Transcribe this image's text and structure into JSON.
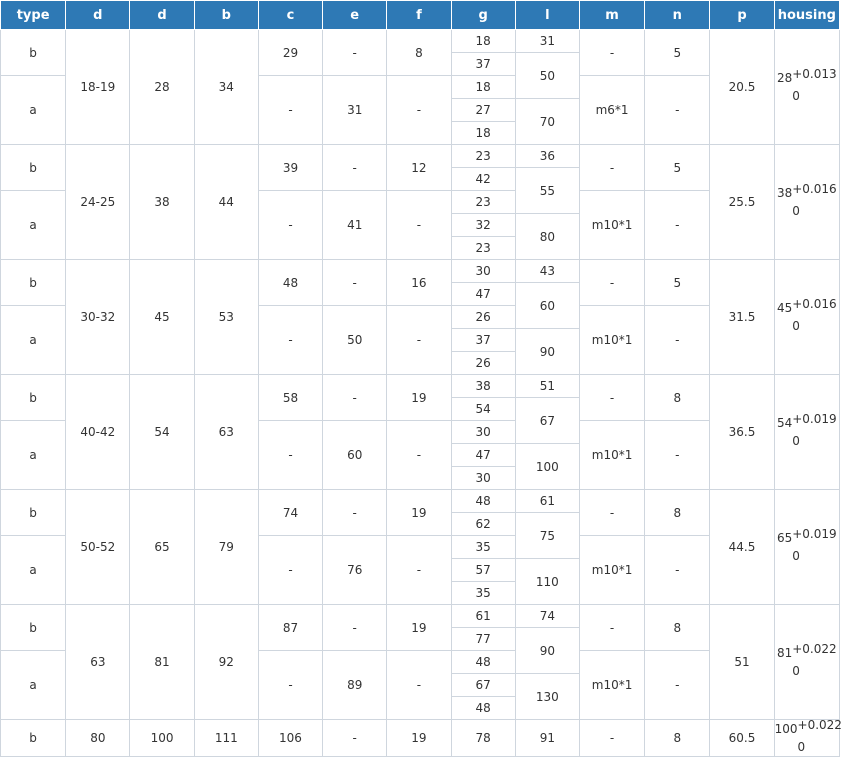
{
  "headers": [
    "type",
    "d",
    "d",
    "b",
    "c",
    "e",
    "f",
    "g",
    "l",
    "m",
    "n",
    "p",
    "housing"
  ],
  "groups": [
    {
      "d": "18-19",
      "d2": "28",
      "b": "34",
      "p": "20.5",
      "housing": {
        "base": "28",
        "upper": "+0.013",
        "lower": "0"
      },
      "b_row": {
        "type": "b",
        "c": "29",
        "e": "-",
        "f": "8",
        "m": "-",
        "n": "5"
      },
      "a_row": {
        "type": "a",
        "c": "-",
        "e": "31",
        "f": "-",
        "m": "m6*1",
        "n": "-"
      },
      "g": [
        "18",
        "37",
        "18",
        "27",
        "18"
      ],
      "l": [
        "31",
        "50",
        "70"
      ]
    },
    {
      "d": "24-25",
      "d2": "38",
      "b": "44",
      "p": "25.5",
      "housing": {
        "base": "38",
        "upper": "+0.016",
        "lower": "0"
      },
      "b_row": {
        "type": "b",
        "c": "39",
        "e": "-",
        "f": "12",
        "m": "-",
        "n": "5"
      },
      "a_row": {
        "type": "a",
        "c": "-",
        "e": "41",
        "f": "-",
        "m": "m10*1",
        "n": "-"
      },
      "g": [
        "23",
        "42",
        "23",
        "32",
        "23"
      ],
      "l": [
        "36",
        "55",
        "80"
      ]
    },
    {
      "d": "30-32",
      "d2": "45",
      "b": "53",
      "p": "31.5",
      "housing": {
        "base": "45",
        "upper": "+0.016",
        "lower": "0"
      },
      "b_row": {
        "type": "b",
        "c": "48",
        "e": "-",
        "f": "16",
        "m": "-",
        "n": "5"
      },
      "a_row": {
        "type": "a",
        "c": "-",
        "e": "50",
        "f": "-",
        "m": "m10*1",
        "n": "-"
      },
      "g": [
        "30",
        "47",
        "26",
        "37",
        "26"
      ],
      "l": [
        "43",
        "60",
        "90"
      ]
    },
    {
      "d": "40-42",
      "d2": "54",
      "b": "63",
      "p": "36.5",
      "housing": {
        "base": "54",
        "upper": "+0.019",
        "lower": "0"
      },
      "b_row": {
        "type": "b",
        "c": "58",
        "e": "-",
        "f": "19",
        "m": "-",
        "n": "8"
      },
      "a_row": {
        "type": "a",
        "c": "-",
        "e": "60",
        "f": "-",
        "m": "m10*1",
        "n": "-"
      },
      "g": [
        "38",
        "54",
        "30",
        "47",
        "30"
      ],
      "l": [
        "51",
        "67",
        "100"
      ]
    },
    {
      "d": "50-52",
      "d2": "65",
      "b": "79",
      "p": "44.5",
      "housing": {
        "base": "65",
        "upper": "+0.019",
        "lower": "0"
      },
      "b_row": {
        "type": "b",
        "c": "74",
        "e": "-",
        "f": "19",
        "m": "-",
        "n": "8"
      },
      "a_row": {
        "type": "a",
        "c": "-",
        "e": "76",
        "f": "-",
        "m": "m10*1",
        "n": "-"
      },
      "g": [
        "48",
        "62",
        "35",
        "57",
        "35"
      ],
      "l": [
        "61",
        "75",
        "110"
      ]
    },
    {
      "d": "63",
      "d2": "81",
      "b": "92",
      "p": "51",
      "housing": {
        "base": "81",
        "upper": "+0.022",
        "lower": "0"
      },
      "b_row": {
        "type": "b",
        "c": "87",
        "e": "-",
        "f": "19",
        "m": "-",
        "n": "8"
      },
      "a_row": {
        "type": "a",
        "c": "-",
        "e": "89",
        "f": "-",
        "m": "m10*1",
        "n": "-"
      },
      "g": [
        "61",
        "77",
        "48",
        "67",
        "48"
      ],
      "l": [
        "74",
        "90",
        "130"
      ]
    }
  ],
  "last_row": {
    "type": "b",
    "d": "80",
    "d2": "100",
    "b": "111",
    "c": "106",
    "e": "-",
    "f": "19",
    "g": "78",
    "l": "91",
    "m": "-",
    "n": "8",
    "p": "60.5",
    "housing": {
      "base": "100",
      "upper": "+0.022",
      "lower": "0"
    }
  }
}
